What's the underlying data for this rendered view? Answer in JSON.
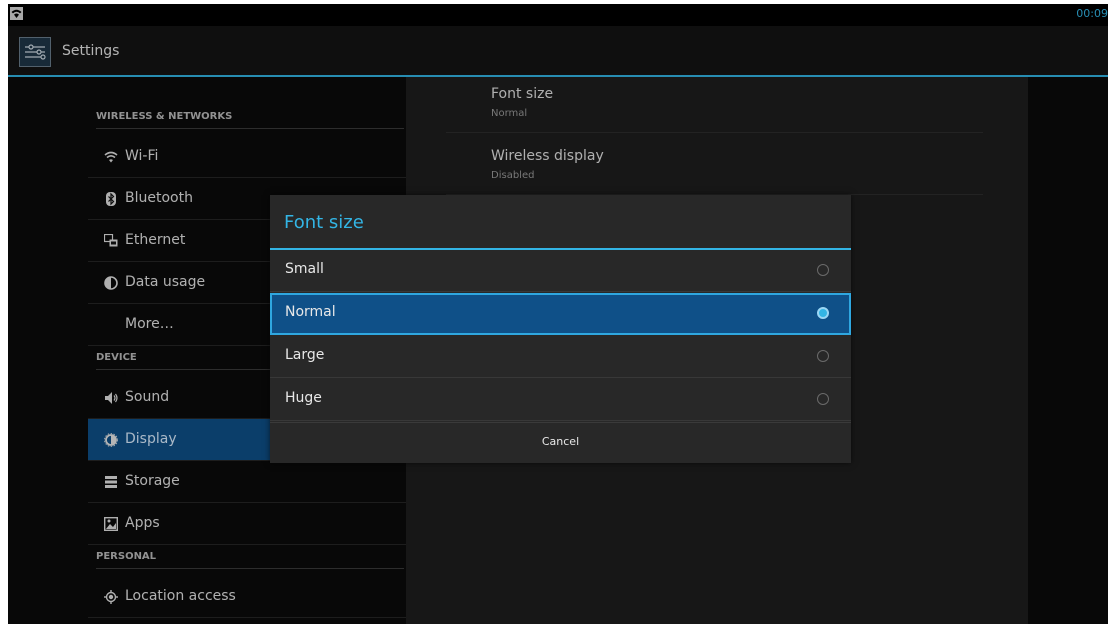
{
  "status_bar": {
    "time": "00:09",
    "wifi_icon": "wifi-icon"
  },
  "action_bar": {
    "title": "Settings",
    "app_icon": "settings-sliders-icon"
  },
  "sidebar": {
    "headers": {
      "wireless": "WIRELESS & NETWORKS",
      "device": "DEVICE",
      "personal": "PERSONAL"
    },
    "items": [
      {
        "label": "Wi-Fi",
        "icon": "wifi-icon"
      },
      {
        "label": "Bluetooth",
        "icon": "bluetooth-icon"
      },
      {
        "label": "Ethernet",
        "icon": "ethernet-icon"
      },
      {
        "label": "Data usage",
        "icon": "data-usage-icon"
      },
      {
        "label": "More…",
        "icon": ""
      },
      {
        "label": "Sound",
        "icon": "sound-icon"
      },
      {
        "label": "Display",
        "icon": "display-icon",
        "selected": true
      },
      {
        "label": "Storage",
        "icon": "storage-icon"
      },
      {
        "label": "Apps",
        "icon": "apps-icon"
      },
      {
        "label": "Location access",
        "icon": "location-icon"
      }
    ]
  },
  "preferences": [
    {
      "title": "Font size",
      "summary": "Normal"
    },
    {
      "title": "Wireless display",
      "summary": "Disabled"
    }
  ],
  "dialog": {
    "title": "Font size",
    "options": [
      {
        "label": "Small",
        "checked": false
      },
      {
        "label": "Normal",
        "checked": true
      },
      {
        "label": "Large",
        "checked": false
      },
      {
        "label": "Huge",
        "checked": false
      }
    ],
    "cancel_label": "Cancel"
  },
  "colors": {
    "accent": "#33b5e5",
    "selected": "#0f5088",
    "background": "#0b0b0b",
    "dialog": "#282828"
  }
}
